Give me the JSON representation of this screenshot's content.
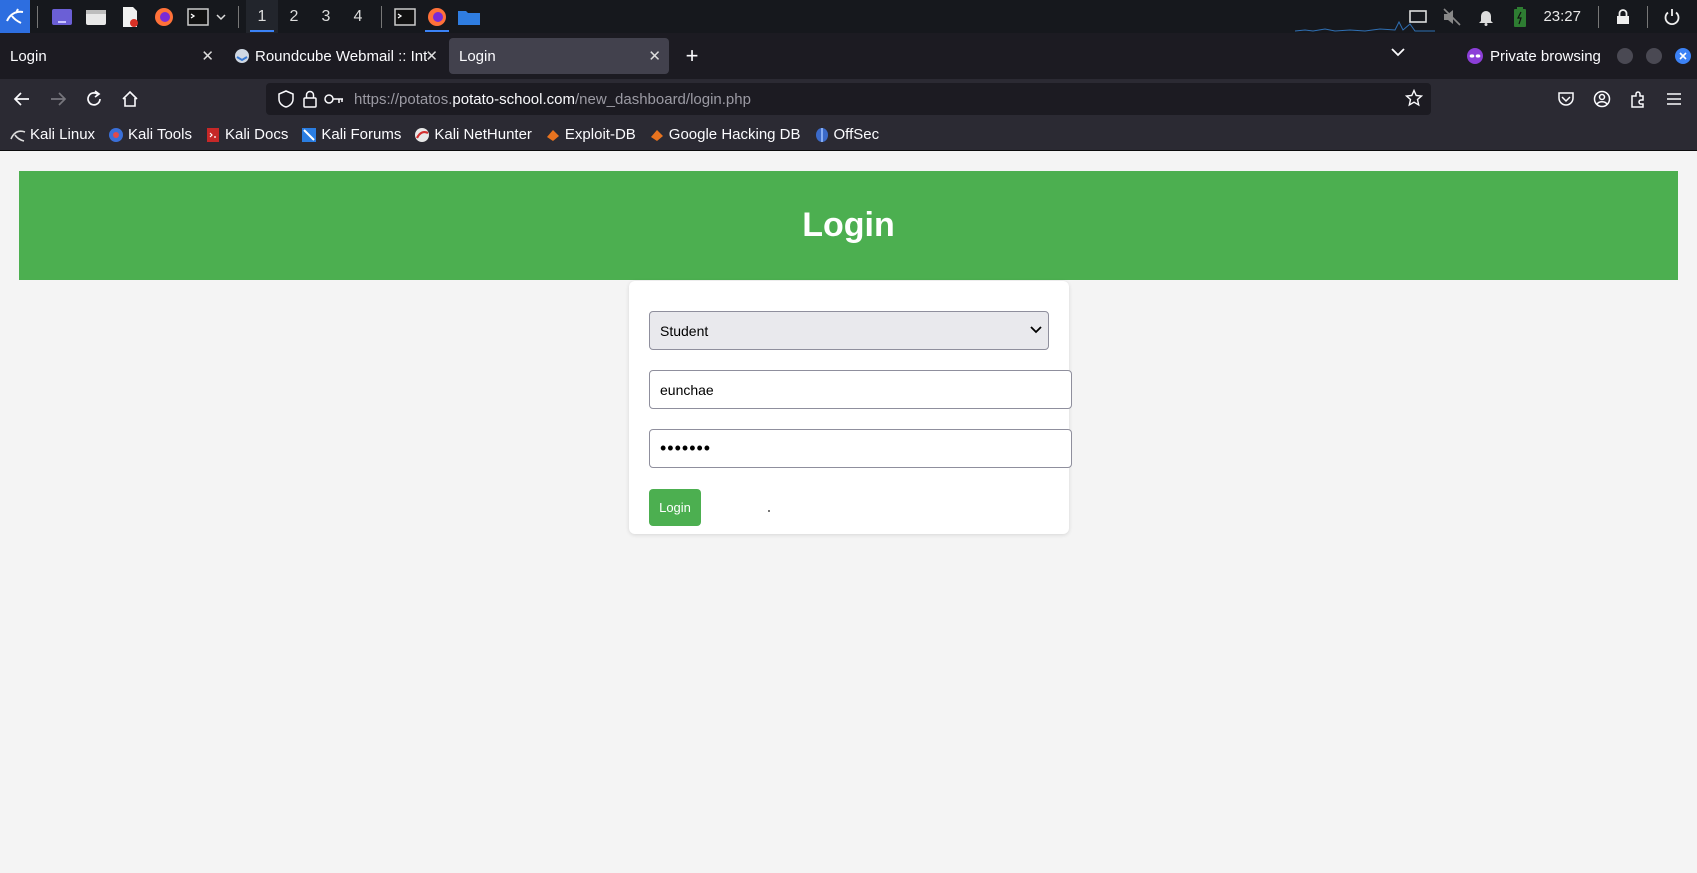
{
  "taskbar": {
    "workspaces": [
      "1",
      "2",
      "3",
      "4"
    ],
    "active_workspace": "1",
    "clock": "23:27",
    "icons": [
      "kali-menu-icon",
      "desktop-icon",
      "files-icon",
      "text-editor-icon",
      "firefox-icon",
      "terminal-icon",
      "dropdown-chevron-icon",
      "terminal-window-icon",
      "firefox-window-icon",
      "folder-window-icon",
      "display-icon",
      "mute-icon",
      "bell-icon",
      "battery-icon",
      "lock-icon"
    ]
  },
  "browser": {
    "tabs": [
      {
        "label": "Login",
        "selected": false
      },
      {
        "label": "Roundcube Webmail :: Int",
        "selected": false
      },
      {
        "label": "Login",
        "selected": true
      }
    ],
    "private_label": "Private browsing",
    "url": {
      "prefix": "https://potatos.",
      "host": "potato-school.com",
      "path": "/new_dashboard/login.php"
    },
    "bookmarks": [
      {
        "label": "Kali Linux",
        "icon": "kali-dragon-icon"
      },
      {
        "label": "Kali Tools",
        "icon": "kali-tools-icon"
      },
      {
        "label": "Kali Docs",
        "icon": "kali-docs-icon"
      },
      {
        "label": "Kali Forums",
        "icon": "kali-forums-icon"
      },
      {
        "label": "Kali NetHunter",
        "icon": "nethunter-icon"
      },
      {
        "label": "Exploit-DB",
        "icon": "exploit-db-icon"
      },
      {
        "label": "Google Hacking DB",
        "icon": "ghdb-icon"
      },
      {
        "label": "OffSec",
        "icon": "offsec-icon"
      }
    ]
  },
  "page": {
    "header_title": "Login",
    "role_select": {
      "selected": "Student"
    },
    "username_value": "eunchae",
    "password_mask": "•••••••",
    "login_button": "Login",
    "colors": {
      "accent": "#4caf50",
      "background": "#f4f4f4"
    }
  }
}
